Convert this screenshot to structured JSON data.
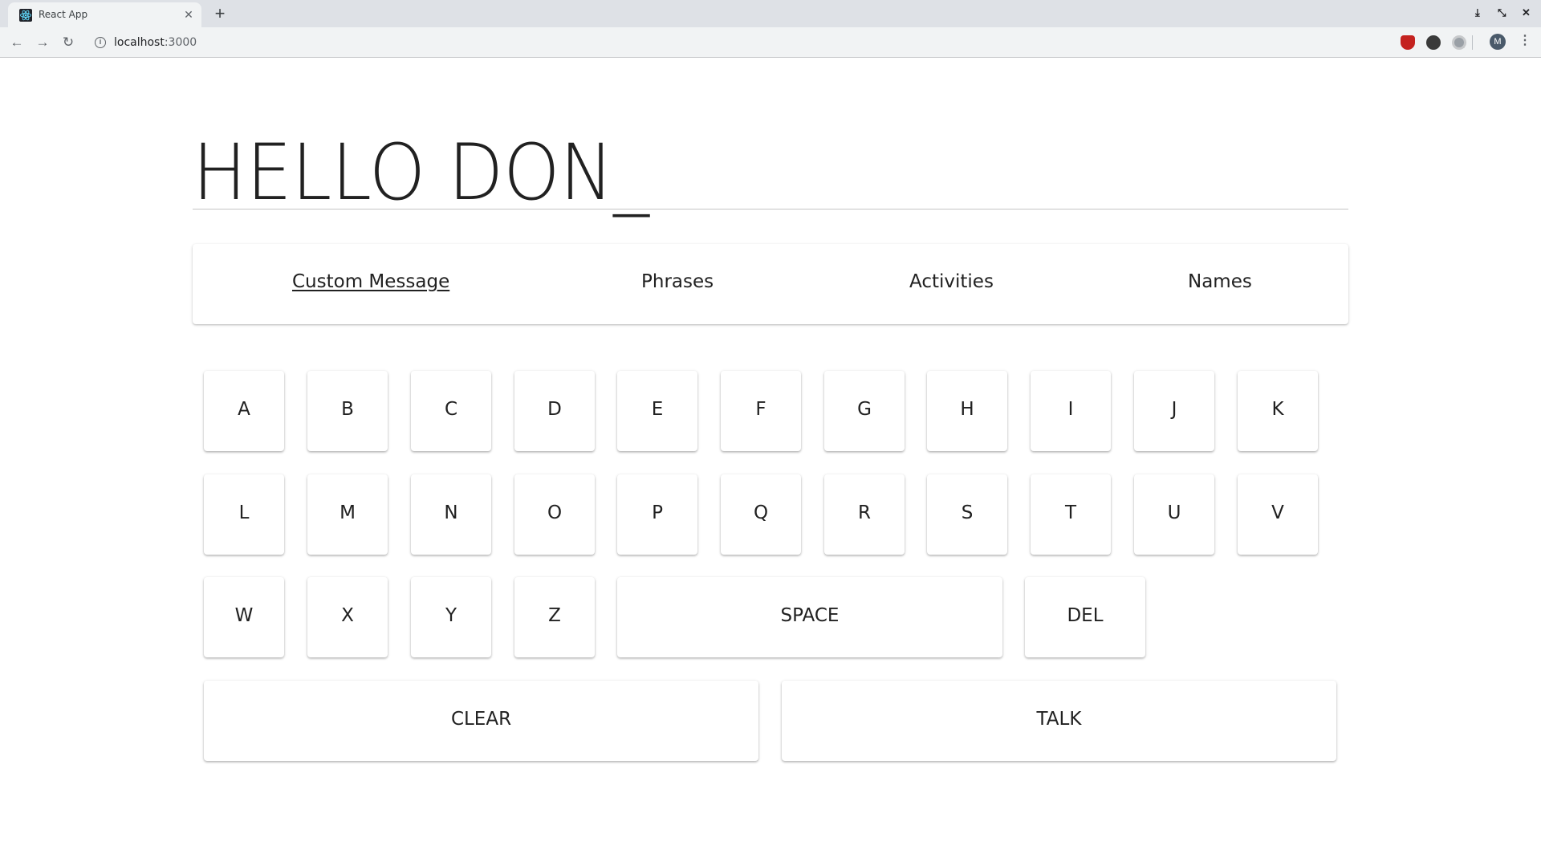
{
  "browser": {
    "tab_title": "React App",
    "url_host": "localhost",
    "url_port": ":3000",
    "icons": [
      "react-favicon",
      "close-icon",
      "plus-icon",
      "back-icon",
      "forward-icon",
      "reload-icon",
      "info-icon",
      "star-icon",
      "ublock-icon",
      "github-icon",
      "extension-icon",
      "menu-icon"
    ],
    "avatar_letter": "M",
    "window_controls": [
      "⤓",
      "⤡",
      "✕"
    ]
  },
  "message": {
    "text": "HELLO DON_"
  },
  "tabs": [
    {
      "label": "Custom Message",
      "active": true
    },
    {
      "label": "Phrases",
      "active": false
    },
    {
      "label": "Activities",
      "active": false
    },
    {
      "label": "Names",
      "active": false
    }
  ],
  "keyboard": {
    "row1": [
      "A",
      "B",
      "C",
      "D",
      "E",
      "F",
      "G",
      "H",
      "I",
      "J",
      "K"
    ],
    "row2": [
      "L",
      "M",
      "N",
      "O",
      "P",
      "Q",
      "R",
      "S",
      "T",
      "U",
      "V"
    ],
    "row3": [
      "W",
      "X",
      "Y",
      "Z"
    ],
    "space_label": "SPACE",
    "del_label": "DEL",
    "clear_label": "CLEAR",
    "talk_label": "TALK"
  }
}
